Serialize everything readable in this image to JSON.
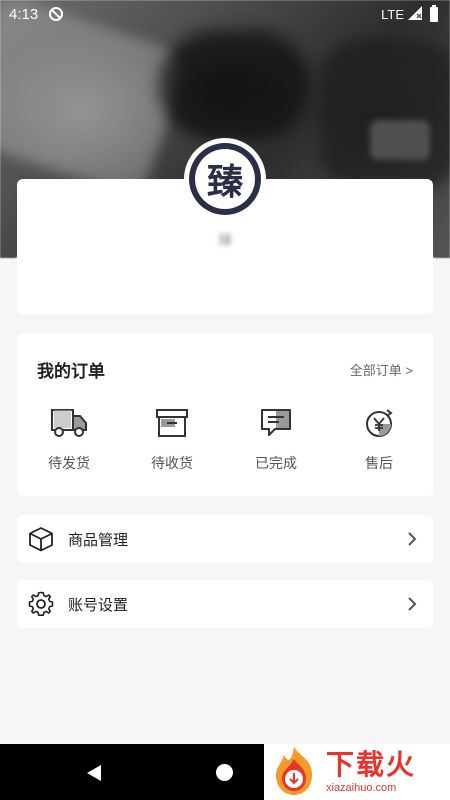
{
  "status_bar": {
    "time": "4:13",
    "network": "LTE"
  },
  "profile": {
    "avatar_glyph": "臻",
    "username": "臻"
  },
  "orders": {
    "title": "我的订单",
    "all_link": "全部订单 >",
    "items": [
      {
        "label": "待发货",
        "icon": "truck-icon"
      },
      {
        "label": "待收货",
        "icon": "box-icon"
      },
      {
        "label": "已完成",
        "icon": "chat-bubble-icon"
      },
      {
        "label": "售后",
        "icon": "yen-refund-icon"
      }
    ]
  },
  "menu": [
    {
      "label": "商品管理",
      "icon": "cube-icon"
    },
    {
      "label": "账号设置",
      "icon": "gear-icon"
    }
  ],
  "watermark": {
    "cn": "下载火",
    "en": "xiazaihuo.com"
  },
  "colors": {
    "accent": "#2b2f45",
    "watermark": "#e8352b"
  }
}
